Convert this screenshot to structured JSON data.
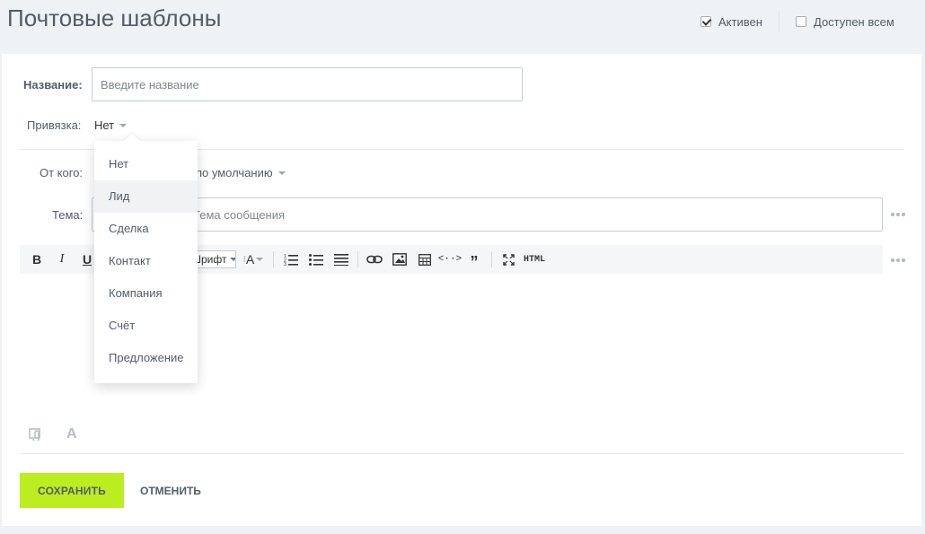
{
  "header": {
    "title": "Почтовые шаблоны",
    "active_label": "Активен",
    "active_checked": true,
    "available_label": "Доступен всем",
    "available_checked": false
  },
  "form": {
    "name_label": "Название:",
    "name_placeholder": "Введите название",
    "binding_label": "Привязка:",
    "binding_value": "Нет",
    "from_label": "От кого:",
    "from_value": "по умолчанию",
    "subject_label": "Тема:",
    "subject_placeholder": "Тема сообщения"
  },
  "toolbar": {
    "bold": "B",
    "italic": "I",
    "underline": "U",
    "font_value": "Шрифт",
    "font_size": "A",
    "html": "HTML"
  },
  "binding_dropdown": {
    "items": [
      "Нет",
      "Лид",
      "Сделка",
      "Контакт",
      "Компания",
      "Счёт",
      "Предложение"
    ],
    "hovered_index": 1
  },
  "actions": {
    "save": "СОХРАНИТЬ",
    "cancel": "ОТМЕНИТЬ"
  }
}
